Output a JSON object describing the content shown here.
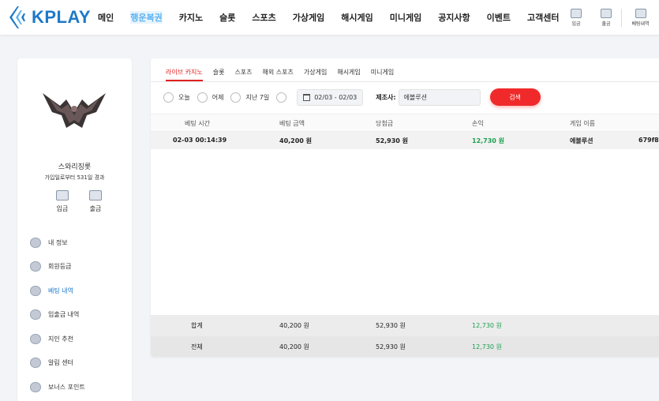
{
  "brand": {
    "logo_text": "KPLAY",
    "accent": "#1d79c9",
    "red": "#f02a2a",
    "green": "#1ea050"
  },
  "nav": {
    "items": [
      "메인",
      "행운복권",
      "카지노",
      "슬롯",
      "스포츠",
      "가상게임",
      "해시게임",
      "미니게임",
      "공지사항",
      "이벤트",
      "고객센터"
    ],
    "active": "행운복권"
  },
  "top_icons": [
    {
      "label": "입금",
      "icon": "wallet-in-icon"
    },
    {
      "label": "출금",
      "icon": "wallet-out-icon"
    },
    {
      "label": "베팅내역",
      "icon": "betting-history-icon"
    }
  ],
  "sidebar": {
    "username": "스와리징롯",
    "joined": "가입일로부터 531일 경과",
    "deposit_label": "입금",
    "withdraw_label": "출금",
    "menu": [
      {
        "label": "내 정보",
        "icon": "user-icon"
      },
      {
        "label": "회원등급",
        "icon": "badge-icon"
      },
      {
        "label": "베팅 내역",
        "icon": "betting-icon",
        "active": true
      },
      {
        "label": "입출금 내역",
        "icon": "transactions-icon"
      },
      {
        "label": "지인 추천",
        "icon": "heart-icon"
      },
      {
        "label": "알림 센터",
        "icon": "chat-icon"
      },
      {
        "label": "보너스 포인트",
        "icon": "bonus-icon"
      }
    ]
  },
  "tabs": [
    "라이브 카지노",
    "슬롯",
    "스포츠",
    "해외 스포츠",
    "가상게임",
    "해시게임",
    "미니게임"
  ],
  "filters": {
    "radios": [
      "오늘",
      "어제",
      "지난 7일",
      ""
    ],
    "date_range": "02/03 - 02/03",
    "provider_label": "제조사:",
    "provider_value": "에볼루션",
    "search_label": "검색"
  },
  "table": {
    "columns": [
      "베팅 시간",
      "베팅 금액",
      "당첨금",
      "손익",
      "게임 이름"
    ],
    "rows": [
      {
        "time": "02-03 00:14:39",
        "bet": "40,200 원",
        "win": "52,930 원",
        "profit": "12,730 원",
        "game": "에볼루션",
        "extra": "679f8"
      }
    ],
    "summary": [
      {
        "label": "합계",
        "bet": "40,200 원",
        "win": "52,930 원",
        "profit": "12,730 원"
      },
      {
        "label": "전체",
        "bet": "40,200 원",
        "win": "52,930 원",
        "profit": "12,730 원"
      }
    ]
  }
}
